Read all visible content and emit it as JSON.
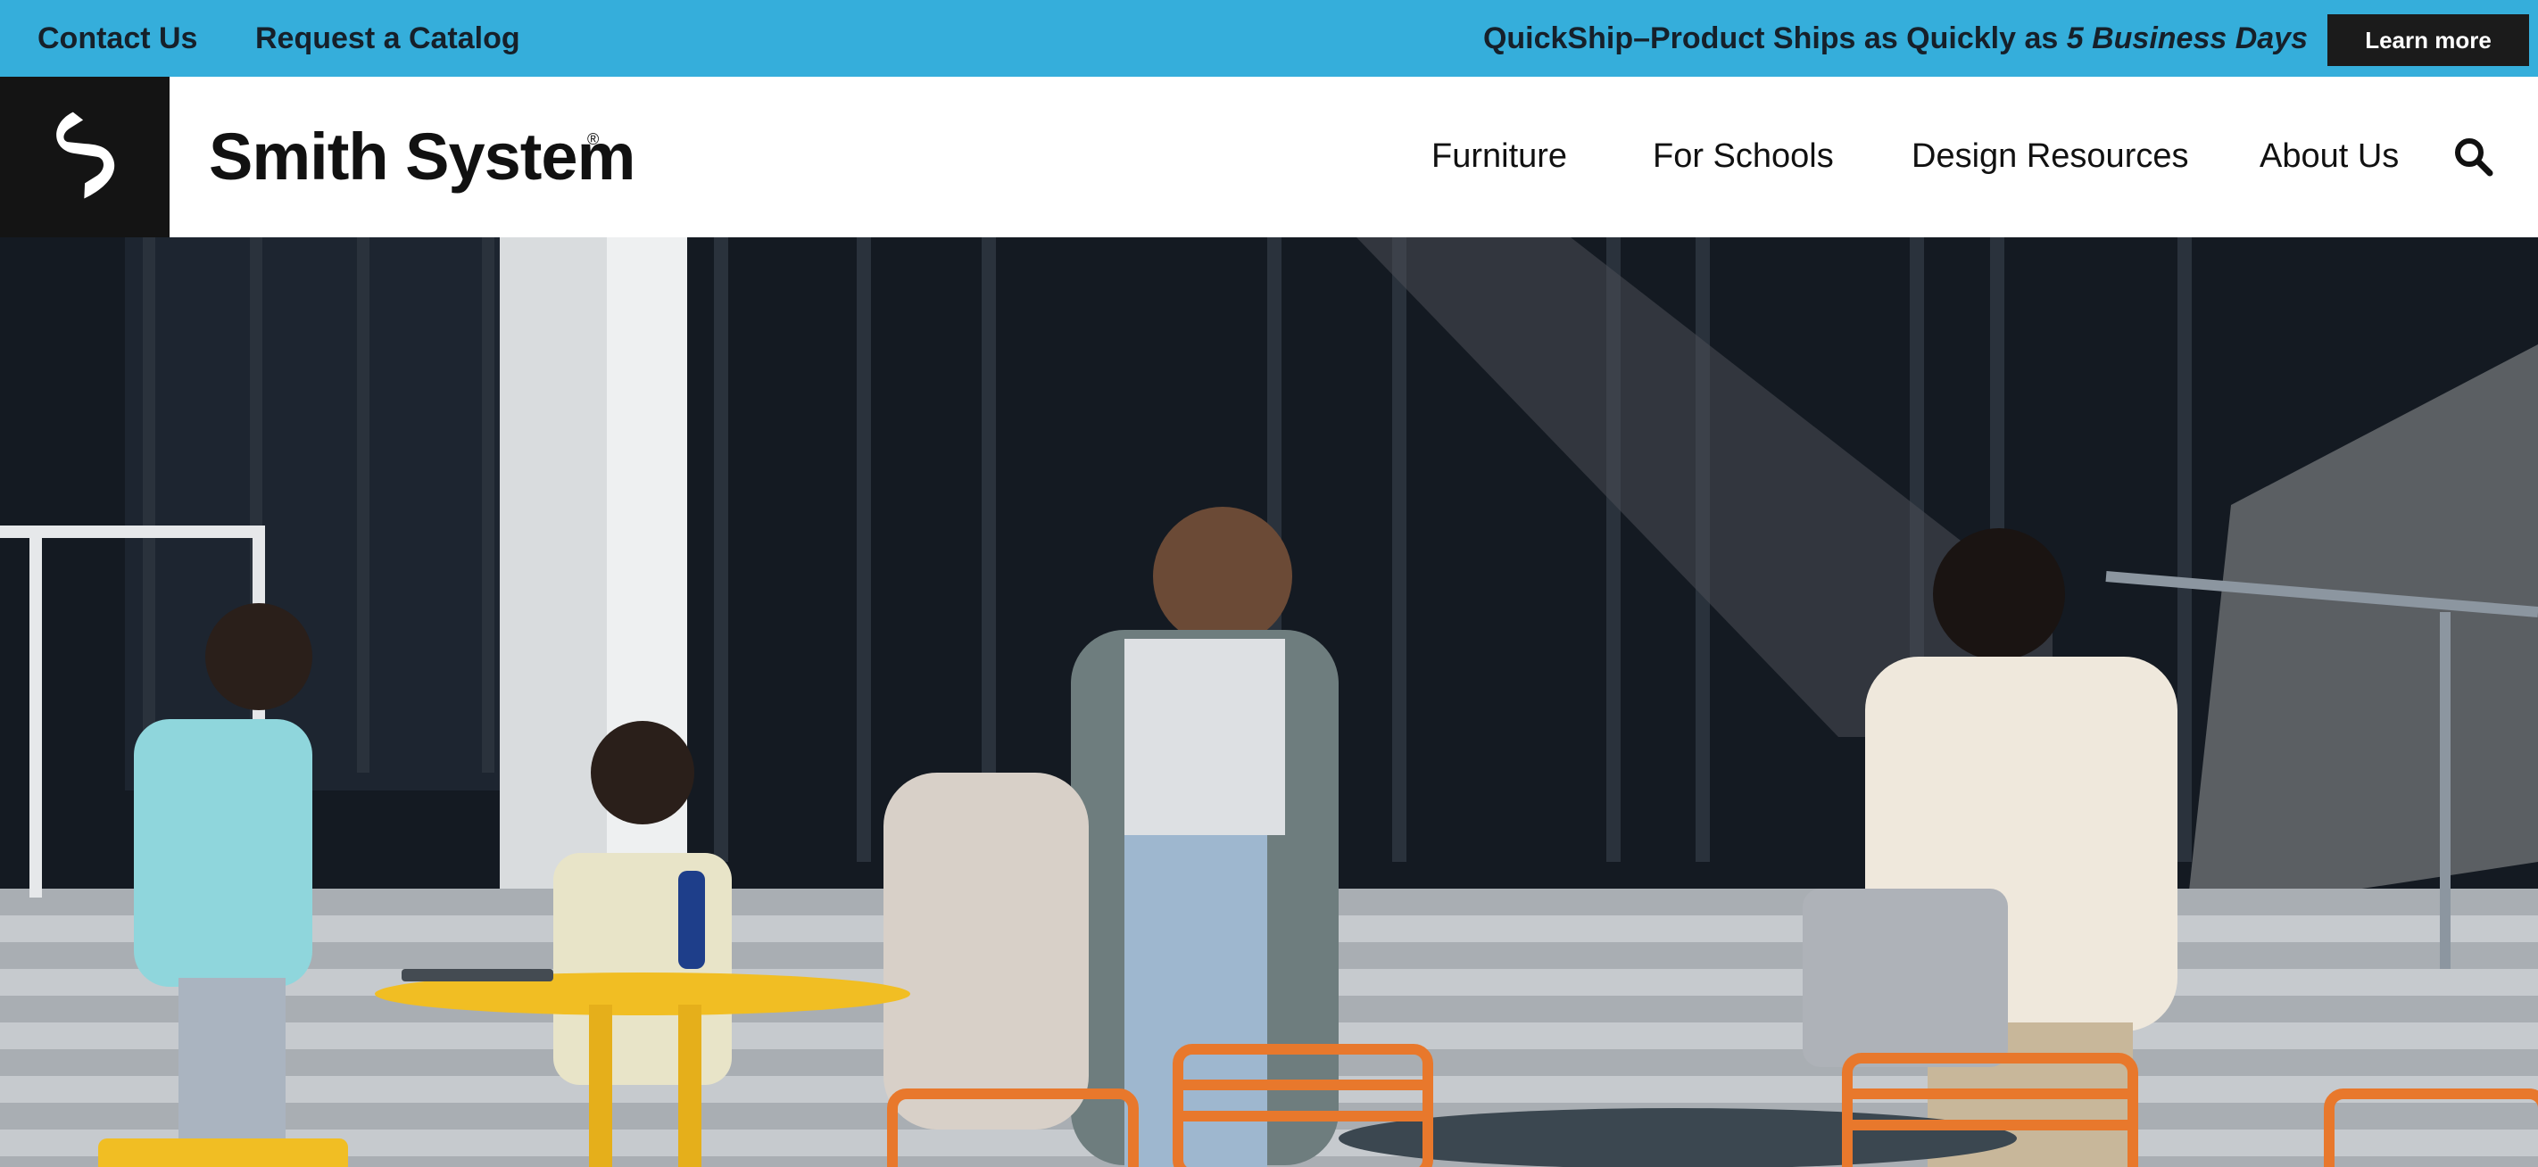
{
  "topbar": {
    "contact": "Contact Us",
    "catalog": "Request a Catalog",
    "promo_text": "QuickShip–Product Ships as Quickly as ",
    "promo_emphasis": "5 Business Days",
    "learn_more": "Learn more",
    "bg_color": "#35aedb"
  },
  "header": {
    "brand": "Smith System",
    "reg_mark": "®",
    "nav": [
      "Furniture",
      "For Schools",
      "Design Resources",
      "About Us"
    ],
    "search_icon": "search-icon"
  },
  "hero": {
    "description_alt": "Students walking past outdoor school furniture"
  }
}
